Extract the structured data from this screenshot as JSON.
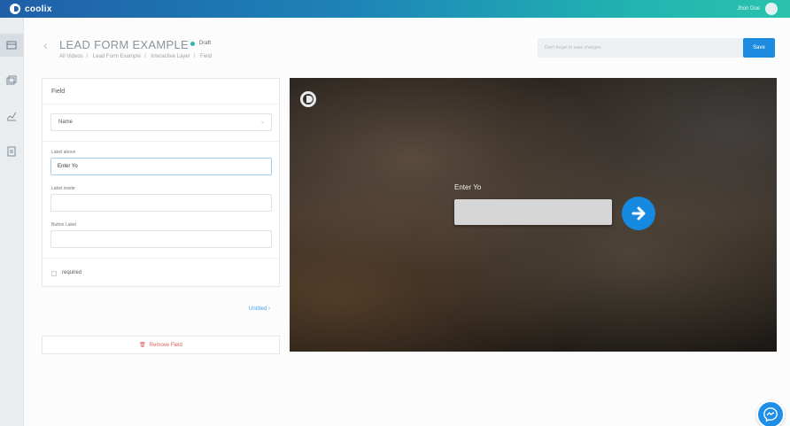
{
  "app": {
    "name": "coolix",
    "user_name": "Jhon Doe"
  },
  "colors": {
    "accent": "#1d8ce0",
    "brand_gradient_start": "#1f5fa8",
    "brand_gradient_end": "#2ac2ad",
    "draft_dot": "#27b7b0",
    "remove": "#e05a5a"
  },
  "sidebar": {
    "items": [
      {
        "icon": "video-layout-icon",
        "active": true
      },
      {
        "icon": "gallery-icon",
        "active": false
      },
      {
        "icon": "analytics-icon",
        "active": false
      },
      {
        "icon": "document-icon",
        "active": false
      }
    ]
  },
  "header": {
    "title": "LEAD FORM EXAMPLE",
    "status": "Draft",
    "breadcrumb": [
      "All Videos",
      "Lead Form Example",
      "Interactive Layer",
      "Field"
    ],
    "save_hint": "Don't forget to save changes.",
    "save_label": "Save"
  },
  "field_panel": {
    "title": "Field",
    "field_type": "Name",
    "label_above_label": "Label above",
    "label_above_value": "Enter Yo",
    "label_inside_label": "Label inside",
    "label_inside_value": "",
    "button_label_label": "Button Label",
    "button_label_value": "",
    "required_label": "required",
    "required_checked": false
  },
  "next_link": "Untitled",
  "remove_label": "Remove Field",
  "preview": {
    "label": "Enter Yo"
  }
}
